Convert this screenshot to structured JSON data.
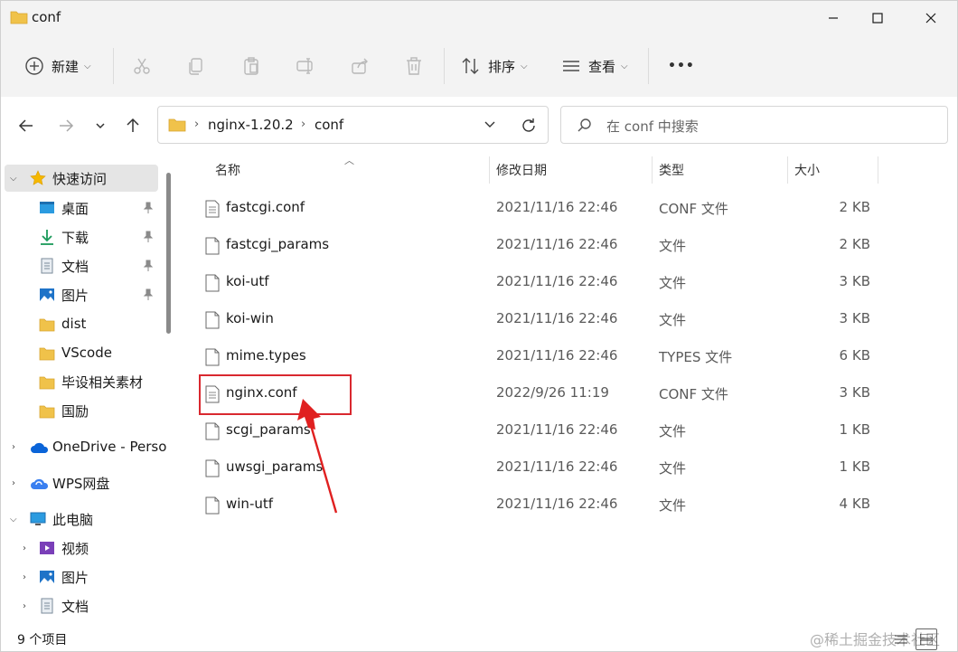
{
  "window": {
    "title": "conf"
  },
  "toolbar": {
    "new_label": "新建",
    "sort_label": "排序",
    "view_label": "查看",
    "more_label": "•••"
  },
  "address": {
    "crumbs": [
      "nginx-1.20.2",
      "conf"
    ],
    "search_placeholder": "在 conf 中搜索"
  },
  "nav": {
    "quick_access": "快速访问",
    "pinned": [
      "桌面",
      "下载",
      "文档",
      "图片"
    ],
    "folders": [
      "dist",
      "VScode",
      "毕设相关素材",
      "国励"
    ],
    "onedrive": "OneDrive - Perso",
    "wps": "WPS网盘",
    "this_pc": "此电脑",
    "pc_items": [
      "视频",
      "图片",
      "文档"
    ]
  },
  "columns": {
    "name": "名称",
    "date": "修改日期",
    "type": "类型",
    "size": "大小"
  },
  "files": [
    {
      "name": "fastcgi.conf",
      "date": "2021/11/16 22:46",
      "type": "CONF 文件",
      "size": "2 KB",
      "icon": "text-file-icon"
    },
    {
      "name": "fastcgi_params",
      "date": "2021/11/16 22:46",
      "type": "文件",
      "size": "2 KB",
      "icon": "blank-file-icon"
    },
    {
      "name": "koi-utf",
      "date": "2021/11/16 22:46",
      "type": "文件",
      "size": "3 KB",
      "icon": "blank-file-icon"
    },
    {
      "name": "koi-win",
      "date": "2021/11/16 22:46",
      "type": "文件",
      "size": "3 KB",
      "icon": "blank-file-icon"
    },
    {
      "name": "mime.types",
      "date": "2021/11/16 22:46",
      "type": "TYPES 文件",
      "size": "6 KB",
      "icon": "blank-file-icon"
    },
    {
      "name": "nginx.conf",
      "date": "2022/9/26 11:19",
      "type": "CONF 文件",
      "size": "3 KB",
      "icon": "text-file-icon"
    },
    {
      "name": "scgi_params",
      "date": "2021/11/16 22:46",
      "type": "文件",
      "size": "1 KB",
      "icon": "blank-file-icon"
    },
    {
      "name": "uwsgi_params",
      "date": "2021/11/16 22:46",
      "type": "文件",
      "size": "1 KB",
      "icon": "blank-file-icon"
    },
    {
      "name": "win-utf",
      "date": "2021/11/16 22:46",
      "type": "文件",
      "size": "4 KB",
      "icon": "blank-file-icon"
    }
  ],
  "status": {
    "count": "9 个项目"
  },
  "watermark": "@稀土掘金技术社区",
  "colors": {
    "highlight": "#d9282f",
    "folder": "#f0c24a",
    "accent": "#0067c0"
  }
}
